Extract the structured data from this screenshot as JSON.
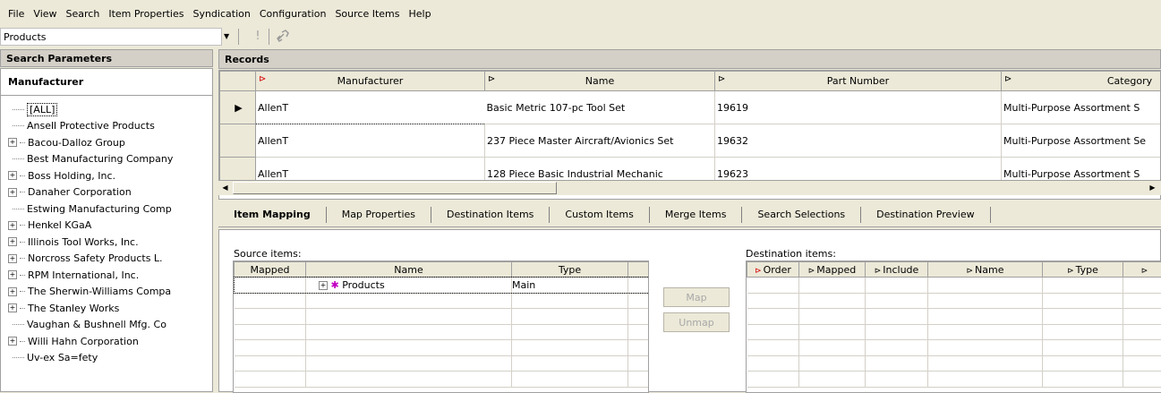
{
  "menu": [
    "File",
    "View",
    "Search",
    "Item Properties",
    "Syndication",
    "Configuration",
    "Source Items",
    "Help"
  ],
  "toolbar": {
    "combo_value": "Products"
  },
  "search_params": {
    "title": "Search Parameters",
    "manufacturer_header": "Manufacturer",
    "manufacturers": [
      {
        "label": "[ALL]",
        "expandable": false
      },
      {
        "label": "Ansell Protective Products",
        "expandable": false
      },
      {
        "label": "Bacou-Dalloz Group",
        "expandable": true
      },
      {
        "label": "Best Manufacturing Company",
        "expandable": false
      },
      {
        "label": "Boss Holding, Inc.",
        "expandable": true
      },
      {
        "label": "Danaher Corporation",
        "expandable": true
      },
      {
        "label": "Estwing Manufacturing Comp",
        "expandable": false
      },
      {
        "label": "Henkel KGaA",
        "expandable": true
      },
      {
        "label": "Illinois Tool Works, Inc.",
        "expandable": true
      },
      {
        "label": "Norcross Safety Products L.",
        "expandable": true
      },
      {
        "label": "RPM International, Inc.",
        "expandable": true
      },
      {
        "label": "The Sherwin-Williams Compa",
        "expandable": true
      },
      {
        "label": "The Stanley Works",
        "expandable": true
      },
      {
        "label": "Vaughan & Bushnell Mfg. Co",
        "expandable": false
      },
      {
        "label": "Willi Hahn Corporation",
        "expandable": true
      },
      {
        "label": "Uv-ex Sa=fety",
        "expandable": false
      }
    ]
  },
  "records": {
    "title": "Records",
    "columns": [
      "Manufacturer",
      "Name",
      "Part Number",
      "Category"
    ],
    "rows": [
      [
        "AllenT",
        "Basic Metric 107-pc Tool Set",
        "19619",
        "Multi-Purpose Assortment S"
      ],
      [
        "AllenT",
        "237 Piece Master Aircraft/Avionics Set",
        "19632",
        "Multi-Purpose Assortment Se"
      ],
      [
        "AllenT",
        "128 Piece Basic Industrial Mechanic",
        "19623",
        "Multi-Purpose Assortment S"
      ]
    ],
    "current_row_marker": "▶"
  },
  "tabs": [
    "Item Mapping",
    "Map Properties",
    "Destination Items",
    "Custom Items",
    "Merge Items",
    "Search Selections",
    "Destination Preview"
  ],
  "mapping": {
    "source_label": "Source items:",
    "source_columns": [
      "Mapped",
      "Name",
      "Type"
    ],
    "source_row": {
      "mapped": "",
      "name": "Products",
      "type": "Main"
    },
    "map_button": "Map",
    "unmap_button": "Unmap",
    "dest_label": "Destination items:",
    "dest_columns": [
      "Order",
      "Mapped",
      "Include",
      "Name",
      "Type"
    ]
  }
}
